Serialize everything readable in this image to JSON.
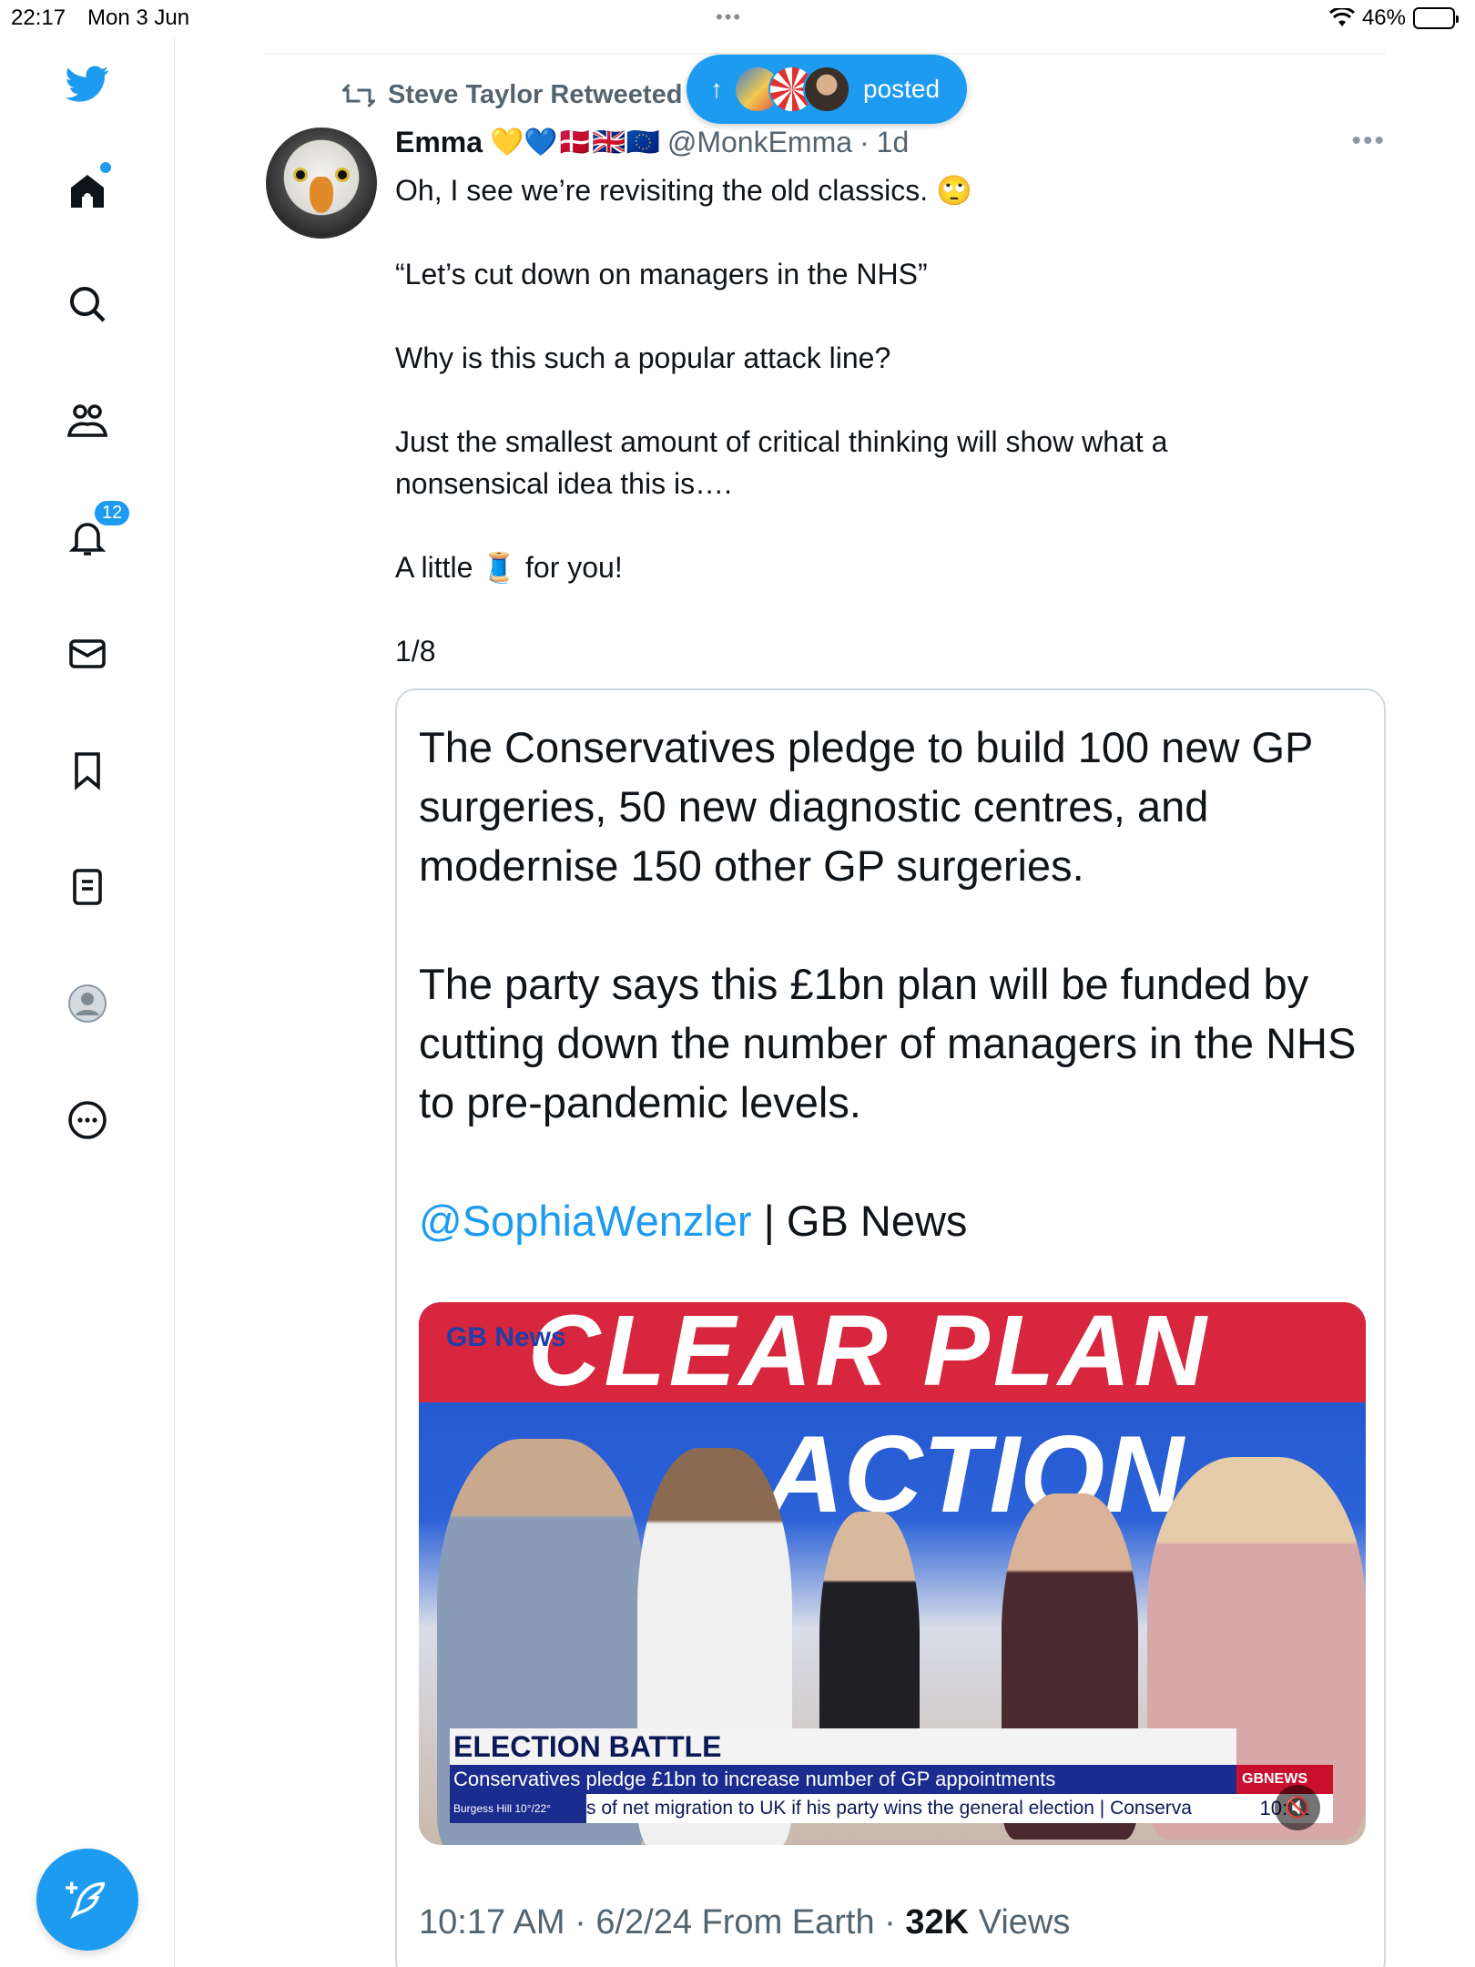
{
  "status_bar": {
    "time": "22:17",
    "date": "Mon 3 Jun",
    "dots": "•••",
    "battery_text": "46%",
    "battery_level": 0.46
  },
  "sidebar": {
    "notifications_badge": "12",
    "brand_color": "#1d9bf0"
  },
  "retweet": {
    "label": "Steve Taylor Retweeted"
  },
  "new_posts_pill": {
    "arrow": "↑",
    "label": "posted"
  },
  "tweet": {
    "author_name": "Emma",
    "author_emojis": "💛💙🇩🇰🇬🇧🇪🇺",
    "handle": "@MonkEmma",
    "separator": "·",
    "age": "1d",
    "lines": [
      "Oh, I see we’re revisiting the old classics. 🙄",
      "“Let’s cut down on managers in the NHS”",
      "Why is this such a popular attack line?",
      "Just the smallest amount of critical thinking will show what a nonsensical idea this is….",
      "A little 🧵 for you!",
      "1/8"
    ]
  },
  "quote": {
    "paragraph1": "The Conservatives pledge to build 100 new GP surgeries, 50 new diagnostic centres, and modernise 150 other GP surgeries.",
    "paragraph2": "The party says this £1bn plan will be funded by cutting down the number of managers in the NHS to pre-pandemic levels.",
    "mention": "@SophiaWenzler",
    "source": " | GB News",
    "video": {
      "logo": "GB News",
      "banner": "CLEAR PLAN",
      "action": "ACTION",
      "lower_third_title": "ELECTION BATTLE",
      "lower_third_sub": "Conservatives pledge £1bn to increase number of GP appointments",
      "weather": "Burgess Hill 10°/22°",
      "ticker": "s of net migration to UK if his party wins the general election  |  Conserva",
      "channel": "GBNEWS",
      "clock": "10:01"
    },
    "meta_time": "10:17 AM",
    "meta_date": "6/2/24",
    "meta_from": "From Earth",
    "meta_views_count": "32K",
    "meta_views_label": "Views"
  }
}
